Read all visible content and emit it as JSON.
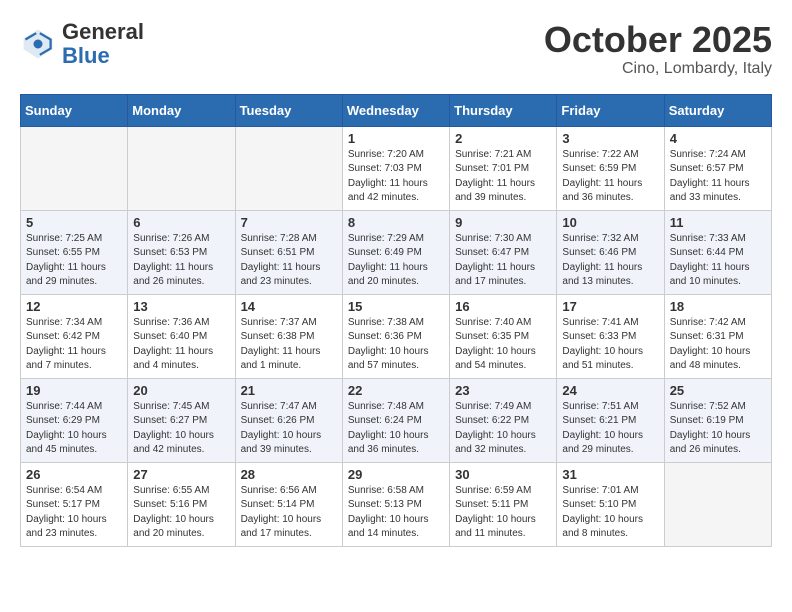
{
  "header": {
    "logo_general": "General",
    "logo_blue": "Blue",
    "month": "October 2025",
    "location": "Cino, Lombardy, Italy"
  },
  "days_of_week": [
    "Sunday",
    "Monday",
    "Tuesday",
    "Wednesday",
    "Thursday",
    "Friday",
    "Saturday"
  ],
  "weeks": [
    [
      {
        "day": "",
        "info": ""
      },
      {
        "day": "",
        "info": ""
      },
      {
        "day": "",
        "info": ""
      },
      {
        "day": "1",
        "info": "Sunrise: 7:20 AM\nSunset: 7:03 PM\nDaylight: 11 hours\nand 42 minutes."
      },
      {
        "day": "2",
        "info": "Sunrise: 7:21 AM\nSunset: 7:01 PM\nDaylight: 11 hours\nand 39 minutes."
      },
      {
        "day": "3",
        "info": "Sunrise: 7:22 AM\nSunset: 6:59 PM\nDaylight: 11 hours\nand 36 minutes."
      },
      {
        "day": "4",
        "info": "Sunrise: 7:24 AM\nSunset: 6:57 PM\nDaylight: 11 hours\nand 33 minutes."
      }
    ],
    [
      {
        "day": "5",
        "info": "Sunrise: 7:25 AM\nSunset: 6:55 PM\nDaylight: 11 hours\nand 29 minutes."
      },
      {
        "day": "6",
        "info": "Sunrise: 7:26 AM\nSunset: 6:53 PM\nDaylight: 11 hours\nand 26 minutes."
      },
      {
        "day": "7",
        "info": "Sunrise: 7:28 AM\nSunset: 6:51 PM\nDaylight: 11 hours\nand 23 minutes."
      },
      {
        "day": "8",
        "info": "Sunrise: 7:29 AM\nSunset: 6:49 PM\nDaylight: 11 hours\nand 20 minutes."
      },
      {
        "day": "9",
        "info": "Sunrise: 7:30 AM\nSunset: 6:47 PM\nDaylight: 11 hours\nand 17 minutes."
      },
      {
        "day": "10",
        "info": "Sunrise: 7:32 AM\nSunset: 6:46 PM\nDaylight: 11 hours\nand 13 minutes."
      },
      {
        "day": "11",
        "info": "Sunrise: 7:33 AM\nSunset: 6:44 PM\nDaylight: 11 hours\nand 10 minutes."
      }
    ],
    [
      {
        "day": "12",
        "info": "Sunrise: 7:34 AM\nSunset: 6:42 PM\nDaylight: 11 hours\nand 7 minutes."
      },
      {
        "day": "13",
        "info": "Sunrise: 7:36 AM\nSunset: 6:40 PM\nDaylight: 11 hours\nand 4 minutes."
      },
      {
        "day": "14",
        "info": "Sunrise: 7:37 AM\nSunset: 6:38 PM\nDaylight: 11 hours\nand 1 minute."
      },
      {
        "day": "15",
        "info": "Sunrise: 7:38 AM\nSunset: 6:36 PM\nDaylight: 10 hours\nand 57 minutes."
      },
      {
        "day": "16",
        "info": "Sunrise: 7:40 AM\nSunset: 6:35 PM\nDaylight: 10 hours\nand 54 minutes."
      },
      {
        "day": "17",
        "info": "Sunrise: 7:41 AM\nSunset: 6:33 PM\nDaylight: 10 hours\nand 51 minutes."
      },
      {
        "day": "18",
        "info": "Sunrise: 7:42 AM\nSunset: 6:31 PM\nDaylight: 10 hours\nand 48 minutes."
      }
    ],
    [
      {
        "day": "19",
        "info": "Sunrise: 7:44 AM\nSunset: 6:29 PM\nDaylight: 10 hours\nand 45 minutes."
      },
      {
        "day": "20",
        "info": "Sunrise: 7:45 AM\nSunset: 6:27 PM\nDaylight: 10 hours\nand 42 minutes."
      },
      {
        "day": "21",
        "info": "Sunrise: 7:47 AM\nSunset: 6:26 PM\nDaylight: 10 hours\nand 39 minutes."
      },
      {
        "day": "22",
        "info": "Sunrise: 7:48 AM\nSunset: 6:24 PM\nDaylight: 10 hours\nand 36 minutes."
      },
      {
        "day": "23",
        "info": "Sunrise: 7:49 AM\nSunset: 6:22 PM\nDaylight: 10 hours\nand 32 minutes."
      },
      {
        "day": "24",
        "info": "Sunrise: 7:51 AM\nSunset: 6:21 PM\nDaylight: 10 hours\nand 29 minutes."
      },
      {
        "day": "25",
        "info": "Sunrise: 7:52 AM\nSunset: 6:19 PM\nDaylight: 10 hours\nand 26 minutes."
      }
    ],
    [
      {
        "day": "26",
        "info": "Sunrise: 6:54 AM\nSunset: 5:17 PM\nDaylight: 10 hours\nand 23 minutes."
      },
      {
        "day": "27",
        "info": "Sunrise: 6:55 AM\nSunset: 5:16 PM\nDaylight: 10 hours\nand 20 minutes."
      },
      {
        "day": "28",
        "info": "Sunrise: 6:56 AM\nSunset: 5:14 PM\nDaylight: 10 hours\nand 17 minutes."
      },
      {
        "day": "29",
        "info": "Sunrise: 6:58 AM\nSunset: 5:13 PM\nDaylight: 10 hours\nand 14 minutes."
      },
      {
        "day": "30",
        "info": "Sunrise: 6:59 AM\nSunset: 5:11 PM\nDaylight: 10 hours\nand 11 minutes."
      },
      {
        "day": "31",
        "info": "Sunrise: 7:01 AM\nSunset: 5:10 PM\nDaylight: 10 hours\nand 8 minutes."
      },
      {
        "day": "",
        "info": ""
      }
    ]
  ]
}
